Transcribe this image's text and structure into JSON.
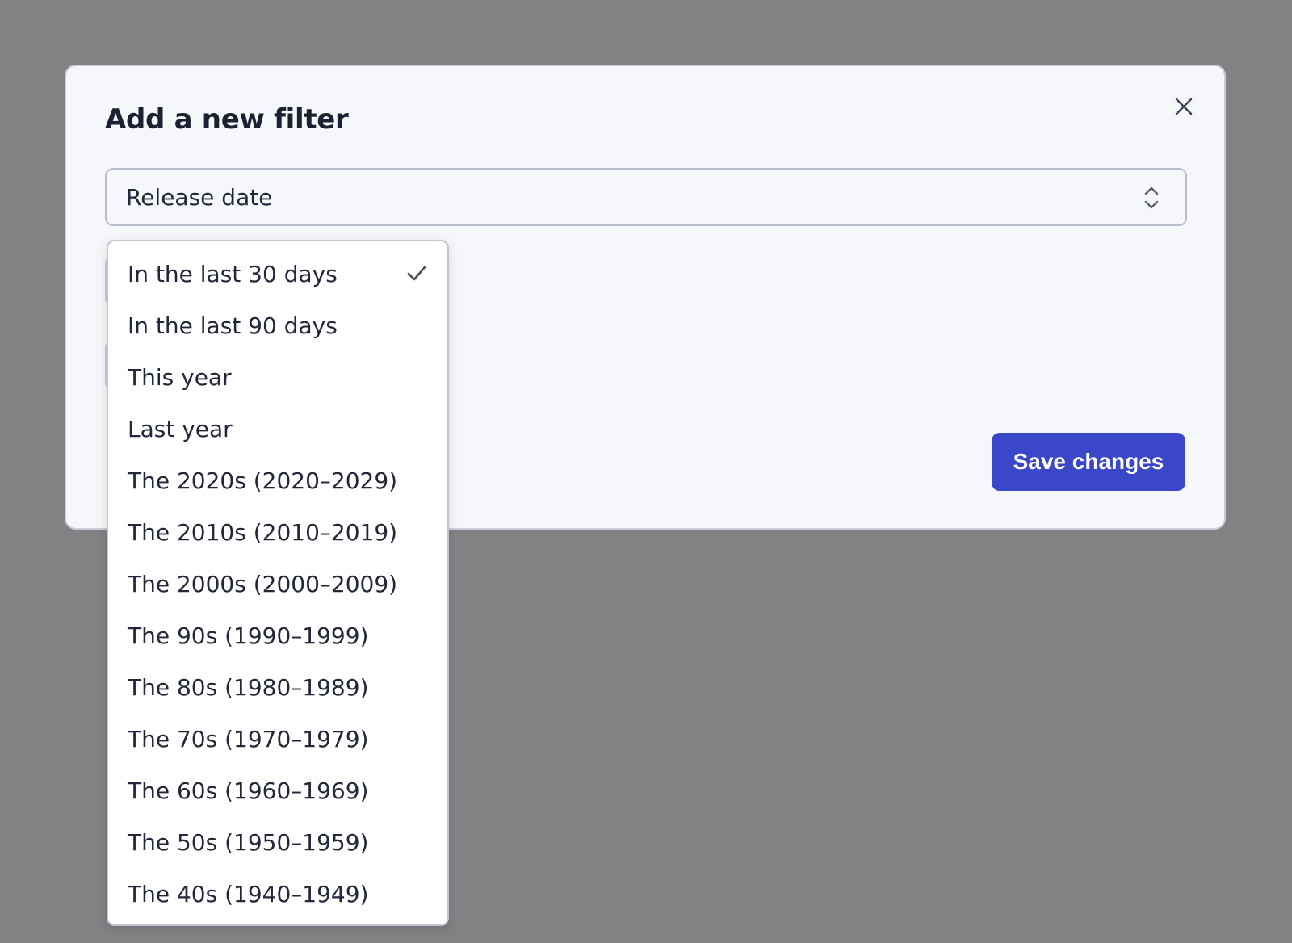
{
  "modal": {
    "title": "Add a new filter",
    "close_icon": "close-icon",
    "save_label": "Save changes"
  },
  "field_select": {
    "value": "Release date",
    "icon": "chevron-up-down-icon"
  },
  "date_dropdown": {
    "selected_index": 0,
    "check_icon": "check-icon",
    "options": [
      "In the last 30 days",
      "In the last 90 days",
      "This year",
      "Last year",
      "The 2020s (2020–2029)",
      "The 2010s (2010–2019)",
      "The 2000s (2000–2009)",
      "The 90s (1990–1999)",
      "The 80s (1980–1989)",
      "The 70s (1970–1979)",
      "The 60s (1960–1969)",
      "The 50s (1950–1959)",
      "The 40s (1940–1949)"
    ]
  },
  "colors": {
    "backdrop": "#828285",
    "modal_bg": "#f5f7fb",
    "accent": "#3b47c9",
    "text": "#1f2233"
  }
}
